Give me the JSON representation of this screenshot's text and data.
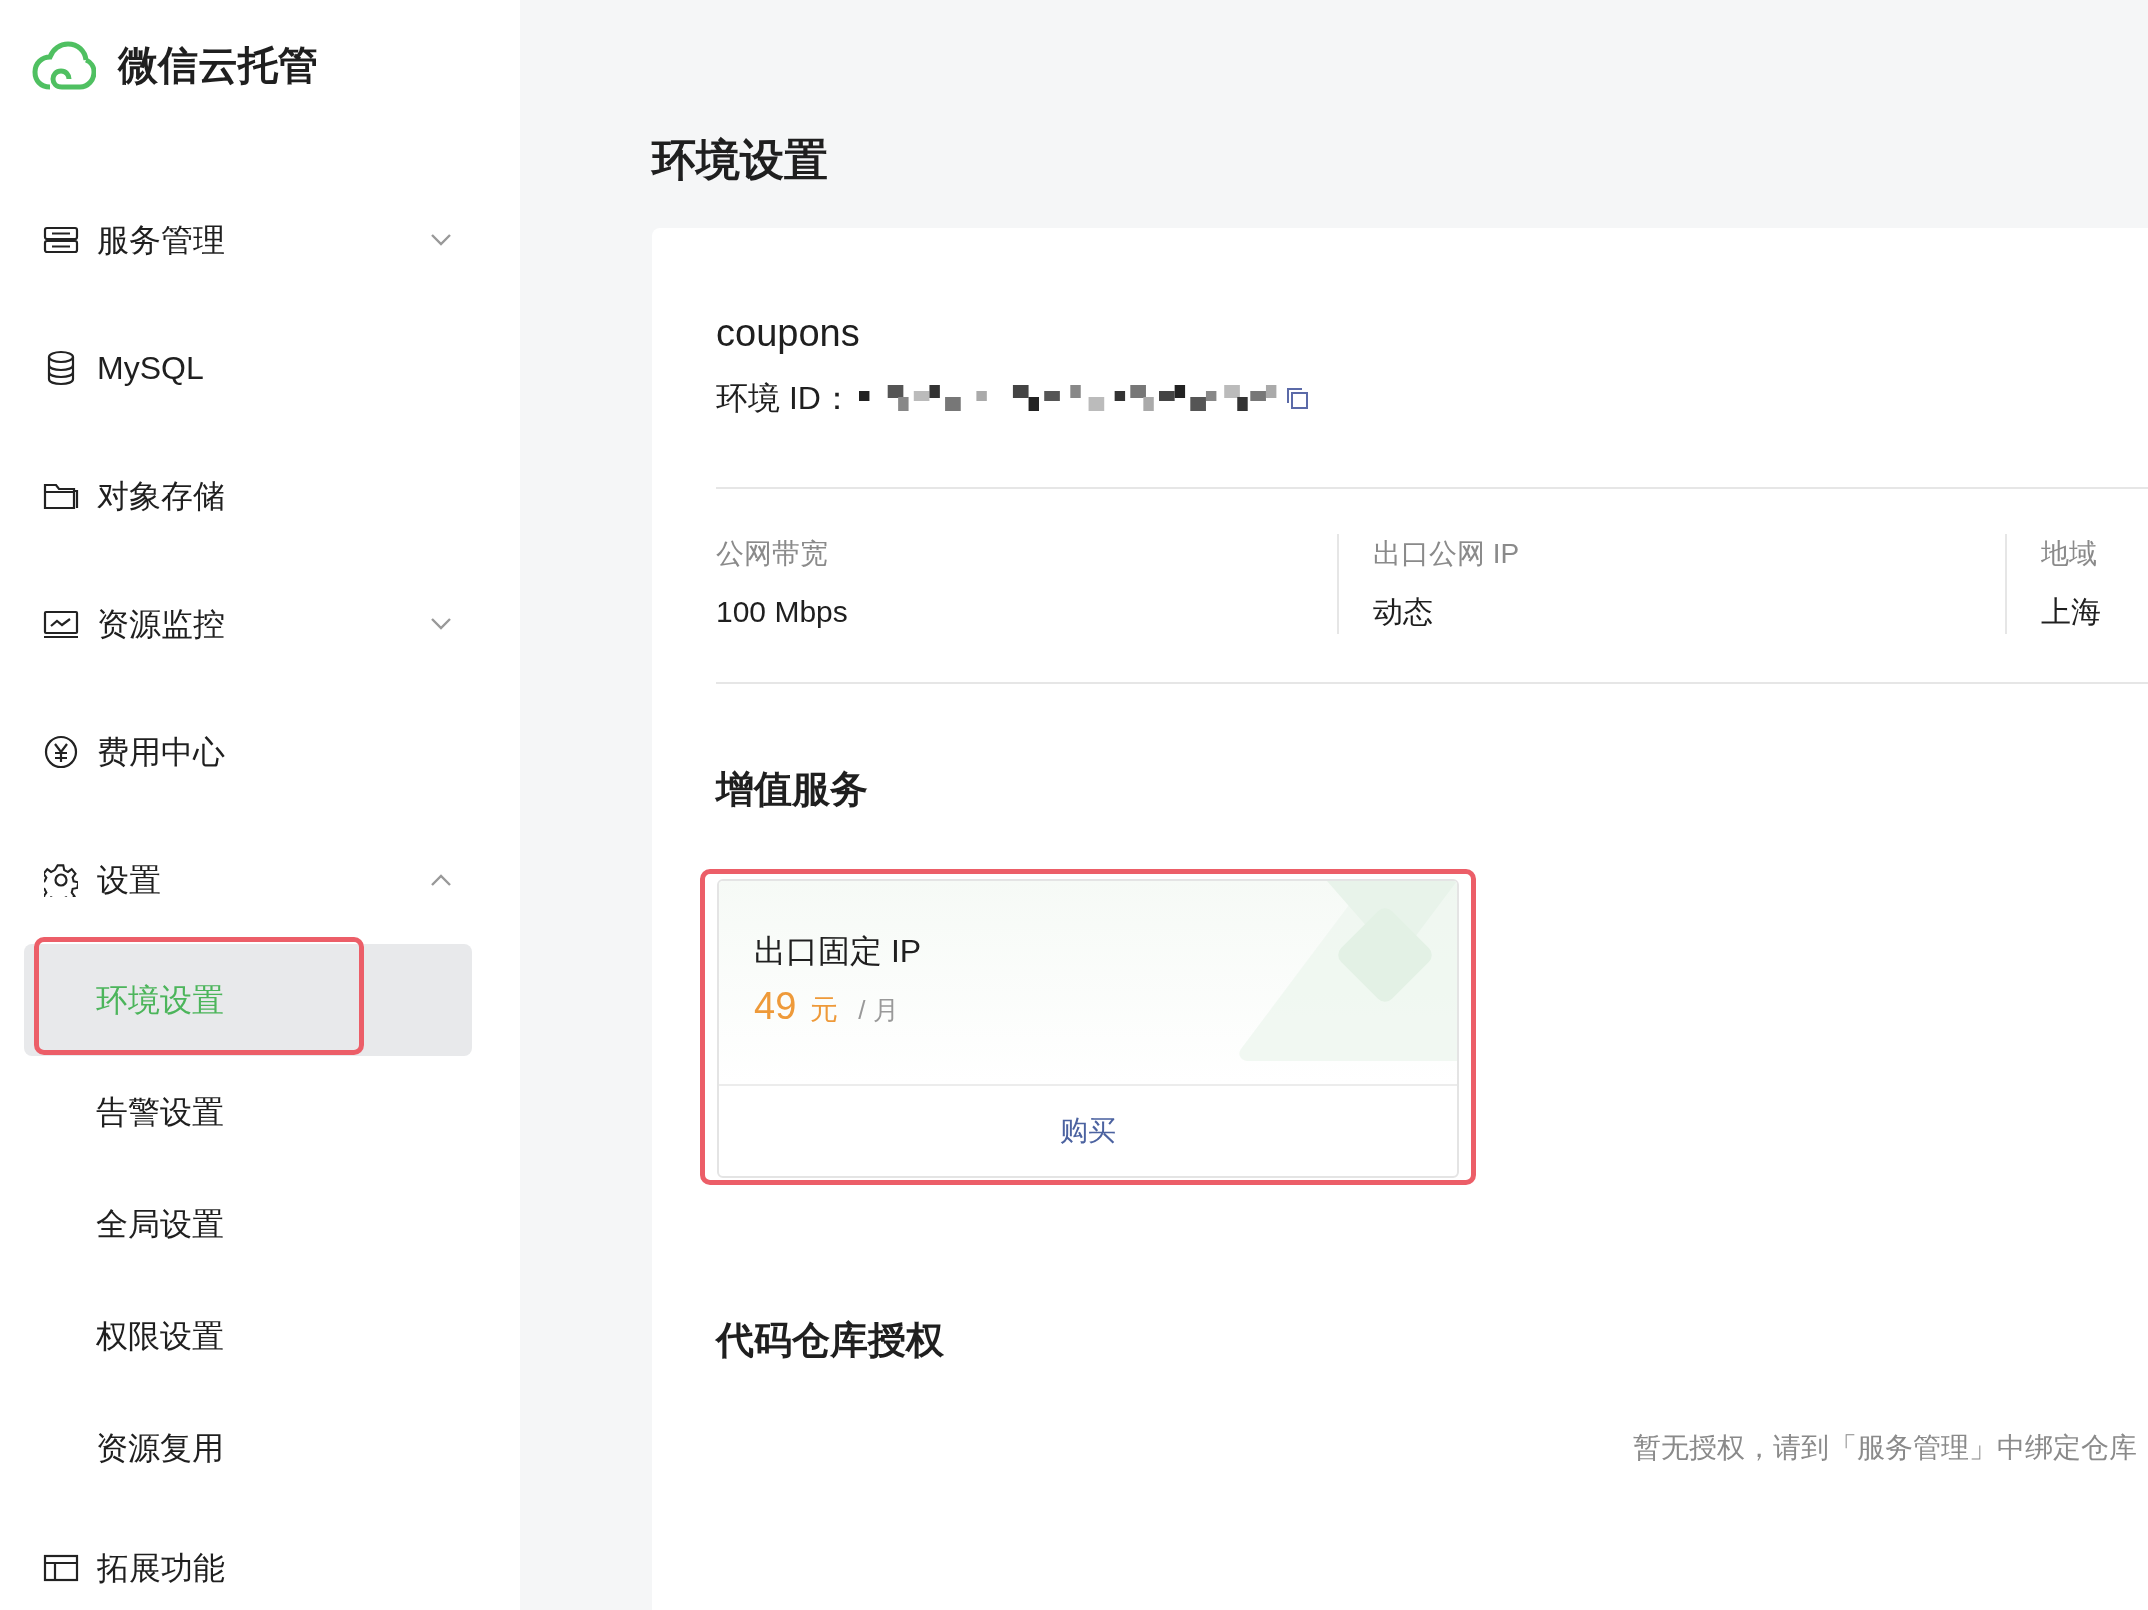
{
  "app": {
    "name": "微信云托管"
  },
  "sidebar": {
    "items": [
      {
        "label": "服务管理",
        "expanded": false
      },
      {
        "label": "MySQL"
      },
      {
        "label": "对象存储"
      },
      {
        "label": "资源监控",
        "expanded": false
      },
      {
        "label": "费用中心"
      },
      {
        "label": "设置",
        "expanded": true,
        "children": [
          {
            "label": "环境设置",
            "selected": true,
            "highlighted": true
          },
          {
            "label": "告警设置",
            "selected": false,
            "highlighted": false
          },
          {
            "label": "全局设置",
            "selected": false,
            "highlighted": false
          },
          {
            "label": "权限设置",
            "selected": false,
            "highlighted": false
          },
          {
            "label": "资源复用",
            "selected": false,
            "highlighted": false
          }
        ]
      },
      {
        "label": "拓展功能"
      }
    ]
  },
  "page": {
    "title": "环境设置",
    "environment": {
      "name": "coupons",
      "id_label": "环境 ID："
    },
    "stats": [
      {
        "label": "公网带宽",
        "value": "100 Mbps"
      },
      {
        "label": "出口公网 IP",
        "value": "动态"
      },
      {
        "label": "地域",
        "value": "上海"
      }
    ],
    "value_added": {
      "heading": "增值服务",
      "services": [
        {
          "title": "出口固定 IP",
          "price": "49",
          "currency": "元",
          "unit": "/ 月",
          "action": "购买",
          "highlighted": true
        }
      ]
    },
    "repo_auth": {
      "heading": "代码仓库授权",
      "empty_text": "暂无授权，请到「服务管理」中绑定仓库"
    }
  }
}
